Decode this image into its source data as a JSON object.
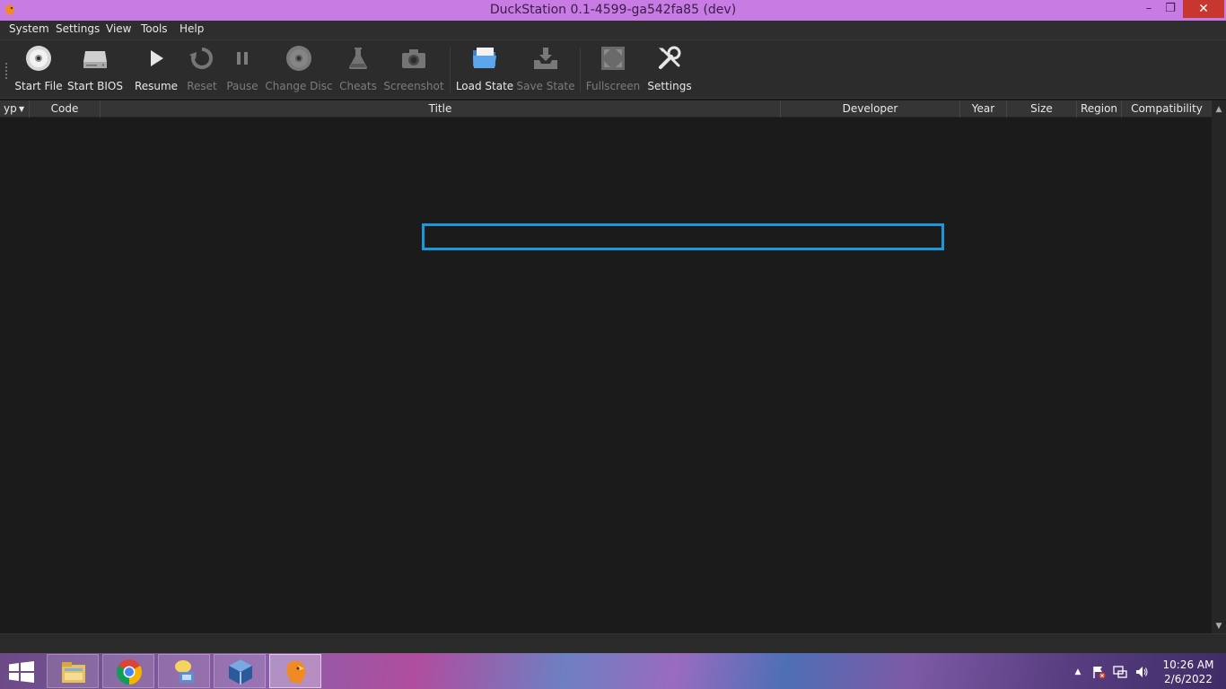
{
  "window": {
    "title": "DuckStation 0.1-4599-ga542fa85 (dev)",
    "minimize": "–",
    "maximize": "❐",
    "close": "✕"
  },
  "menubar": {
    "items": [
      "System",
      "Settings",
      "View",
      "Tools",
      "Help"
    ]
  },
  "toolbar": {
    "buttons": [
      {
        "label": "Start File",
        "icon": "disc-icon",
        "enabled": true
      },
      {
        "label": "Start BIOS",
        "icon": "drive-icon",
        "enabled": true
      },
      {
        "label": "Resume",
        "icon": "play-icon",
        "enabled": true
      },
      {
        "label": "Reset",
        "icon": "reset-icon",
        "enabled": false
      },
      {
        "label": "Pause",
        "icon": "pause-icon",
        "enabled": false
      },
      {
        "label": "Change Disc",
        "icon": "disc-icon",
        "enabled": false
      },
      {
        "label": "Cheats",
        "icon": "flask-icon",
        "enabled": false
      },
      {
        "label": "Screenshot",
        "icon": "camera-icon",
        "enabled": false
      },
      {
        "label": "Load State",
        "icon": "folder-open-icon",
        "enabled": true
      },
      {
        "label": "Save State",
        "icon": "save-tray-icon",
        "enabled": false
      },
      {
        "label": "Fullscreen",
        "icon": "fullscreen-icon",
        "enabled": false
      },
      {
        "label": "Settings",
        "icon": "wrench-screwdriver-icon",
        "enabled": true
      }
    ]
  },
  "gamelist": {
    "columns": [
      "yp",
      "Code",
      "Title",
      "Developer",
      "Year",
      "Size",
      "Region",
      "Compatibility"
    ],
    "rows": []
  },
  "taskbar": {
    "apps": [
      "file-explorer-icon",
      "chrome-icon",
      "messenger-icon",
      "virtualbox-icon",
      "duckstation-icon"
    ],
    "active_app": "duckstation-icon"
  },
  "tray": {
    "time": "10:26 AM",
    "date": "2/6/2022"
  },
  "colors": {
    "titlebar": "#c87be2",
    "focus_outline": "#1a99d8",
    "close_button": "#c7372f"
  }
}
